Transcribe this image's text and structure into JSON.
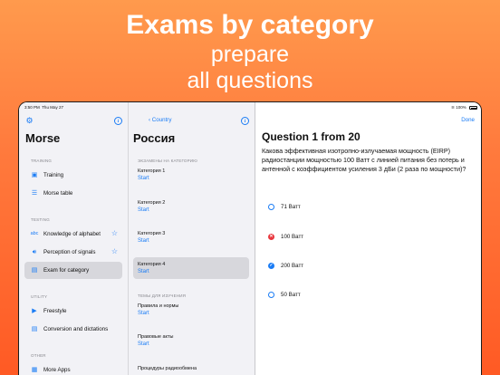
{
  "hero": {
    "title": "Exams by category",
    "subtitle_line1": "prepare",
    "subtitle_line2": "all questions"
  },
  "status_bar": {
    "time": "3:50 PM",
    "date": "Thu May 27",
    "battery": "100%"
  },
  "sidebar": {
    "title": "Morse",
    "sections": [
      {
        "header": "TRAINING",
        "items": [
          {
            "label": "Training",
            "icon": "book-icon"
          },
          {
            "label": "Morse table",
            "icon": "list-icon"
          }
        ]
      },
      {
        "header": "TESTING",
        "items": [
          {
            "label": "Knowledge of alphabet",
            "icon": "abc-icon",
            "star": true
          },
          {
            "label": "Perception of signals",
            "icon": "speaker-icon",
            "star": true
          },
          {
            "label": "Exam for category",
            "icon": "id-card-icon",
            "selected": true
          }
        ]
      },
      {
        "header": "UTILITY",
        "items": [
          {
            "label": "Freestyle",
            "icon": "play-square-icon"
          },
          {
            "label": "Conversion and dictations",
            "icon": "note-icon"
          }
        ]
      },
      {
        "header": "OTHER",
        "items": [
          {
            "label": "More Apps",
            "icon": "grid-icon"
          }
        ]
      }
    ]
  },
  "middle": {
    "back_label": "Country",
    "title": "Россия",
    "sections": [
      {
        "header": "ЭКЗАМЕНЫ НА КАТЕГОРИЮ",
        "items": [
          {
            "name": "Категория 1",
            "action": "Start"
          },
          {
            "name": "Категория 2",
            "action": "Start"
          },
          {
            "name": "Категория 3",
            "action": "Start"
          },
          {
            "name": "Категория 4",
            "action": "Start",
            "selected": true
          }
        ]
      },
      {
        "header": "ТЕМЫ ДЛЯ ИЗУЧЕНИЯ",
        "items": [
          {
            "name": "Правила и нормы",
            "action": "Start"
          },
          {
            "name": "Правовые акты",
            "action": "Start"
          },
          {
            "name": "Процедуры радиообмена",
            "action": ""
          }
        ]
      }
    ]
  },
  "question": {
    "done_label": "Done",
    "title": "Question 1 from 20",
    "text": "Какова эффективная изотропно-излучаемая мощность (EIRP) радиостанции мощностью 100 Ватт с линией питания без потерь и антенной с коэффициентом усиления 3 дБи (2 раза по мощности)?",
    "answers": [
      {
        "label": "71 Ватт",
        "state": "empty"
      },
      {
        "label": "100 Ватт",
        "state": "wrong"
      },
      {
        "label": "200 Ватт",
        "state": "right"
      },
      {
        "label": "50 Ватт",
        "state": "empty"
      }
    ]
  },
  "colors": {
    "accent": "#1a7cf5",
    "wrong": "#e8363d",
    "background_top": "#ff9a4d",
    "background_bottom": "#ff5a24"
  }
}
